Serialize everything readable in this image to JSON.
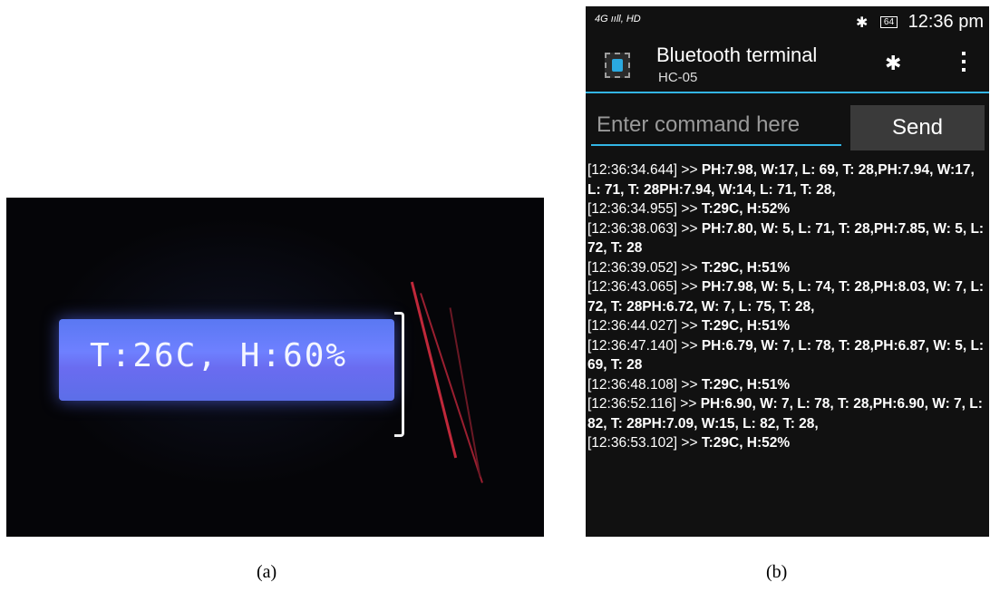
{
  "panel_a": {
    "lcd_text": "T:26C, H:60%",
    "caption": "(a)"
  },
  "panel_b": {
    "caption": "(b)",
    "status_bar": {
      "signal": "4G ııll, HD",
      "battery": "64",
      "time": "12:36 pm"
    },
    "app_bar": {
      "title": "Bluetooth terminal",
      "subtitle": "HC-05"
    },
    "command": {
      "placeholder": "Enter command here",
      "value": "",
      "send_label": "Send"
    },
    "log": [
      {
        "ts": "[12:36:34.644]",
        "arrow": " >> ",
        "msg": "PH:7.98, W:17, L: 69, T: 28,PH:7.94, W:17, L: 71, T: 28PH:7.94, W:14, L: 71, T: 28,"
      },
      {
        "ts": "[12:36:34.955]",
        "arrow": " >> ",
        "msg": "T:29C, H:52%"
      },
      {
        "ts": "[12:36:38.063]",
        "arrow": " >> ",
        "msg": "PH:7.80, W: 5, L: 71, T: 28,PH:7.85, W: 5, L: 72, T: 28"
      },
      {
        "ts": "[12:36:39.052]",
        "arrow": " >> ",
        "msg": "T:29C, H:51%"
      },
      {
        "ts": "[12:36:43.065]",
        "arrow": " >> ",
        "msg": "PH:7.98, W: 5, L: 74, T: 28,PH:8.03, W: 7, L: 72, T: 28PH:6.72, W: 7, L: 75, T: 28,"
      },
      {
        "ts": "[12:36:44.027]",
        "arrow": " >> ",
        "msg": "T:29C, H:51%"
      },
      {
        "ts": "[12:36:47.140]",
        "arrow": " >> ",
        "msg": "PH:6.79, W: 7, L: 78, T: 28,PH:6.87, W: 5, L: 69, T: 28"
      },
      {
        "ts": "[12:36:48.108]",
        "arrow": " >> ",
        "msg": "T:29C, H:51%"
      },
      {
        "ts": "[12:36:52.116]",
        "arrow": " >> ",
        "msg": "PH:6.90, W: 7, L: 78, T: 28,PH:6.90, W: 7, L: 82, T: 28PH:7.09, W:15, L: 82, T: 28,"
      },
      {
        "ts": "[12:36:53.102]",
        "arrow": " >> ",
        "msg": "T:29C, H:52%"
      }
    ]
  },
  "colors": {
    "accent": "#33b5e5",
    "screen_bg": "#111111",
    "lcd_backlight": "#6e80ff"
  },
  "icons": [
    "bluetooth-icon",
    "battery-icon",
    "app-chip-icon",
    "bluetooth-action-icon",
    "overflow-menu-icon"
  ]
}
